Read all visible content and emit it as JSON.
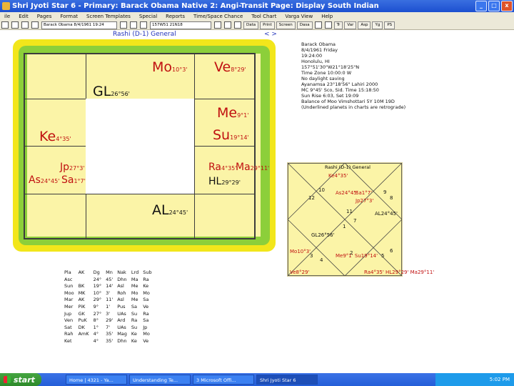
{
  "window": {
    "title": "Shri Jyoti Star 6  - Primary: Barack Obama      Native 2: Angi-Transit         Page: Display South Indian",
    "minimize": "_",
    "maximize": "□",
    "close": "x"
  },
  "menu": [
    "ile",
    "Edit",
    "Pages",
    "Format",
    "Screen Templates",
    "Special",
    "Reports",
    "Time/Space Chance",
    "Tool Chart",
    "Varga View",
    "Help"
  ],
  "toolbar": {
    "date_field": "Barack Obama 8/4/1961 19:24",
    "coord_field": "157W51 21N18",
    "buttons": [
      "Data",
      "Print",
      "Screen",
      "Dasa",
      "Tr",
      "Var",
      "Asp",
      "Yg",
      "PS"
    ]
  },
  "chart": {
    "title": "Rashi (D-1) General",
    "nav": "< >",
    "Mo": {
      "name": "Mo",
      "deg": "10°3'"
    },
    "Ve": {
      "name": "Ve",
      "deg": "8°29'"
    },
    "GL": {
      "name": "GL",
      "deg": "26°56'"
    },
    "Me": {
      "name": "Me",
      "deg": "9°1'"
    },
    "Su": {
      "name": "Su",
      "deg": "19°14'"
    },
    "Ke": {
      "name": "Ke",
      "deg": "4°35'"
    },
    "Jp": {
      "name": "Jp",
      "deg": "27°3'"
    },
    "As": {
      "name": "As",
      "deg": "24°45'"
    },
    "Sa": {
      "name": "Sa",
      "deg": "1°7'"
    },
    "Ra": {
      "name": "Ra",
      "deg": "4°35'"
    },
    "Ma": {
      "name": "Ma",
      "deg": "29°11'"
    },
    "HL": {
      "name": "HL",
      "deg": "29°29'"
    },
    "AL": {
      "name": "AL",
      "deg": "24°45'"
    }
  },
  "info": {
    "lines": [
      "Barack Obama",
      "8/4/1961 Friday",
      "19:24:00",
      "Honolulu, HI",
      "157°51'30\"W21°18'25\"N",
      "Time Zone 10:00:0 W",
      "No daylight saving",
      "Ayanamsa 23°18'56\" Lahiri 2000",
      "MC 9°45' Sco, Sid. Time 15:18:50",
      "Sun Rise 6:03, Set 19:09",
      "Balance of Moo Vimshottari 5Y 10M 19D",
      "(Underlined planets in charts are retrograde)"
    ]
  },
  "small_chart": {
    "title": "Rashi (D-1) General",
    "labels": {
      "ke": "Ke4°35'",
      "as": "As24°45'",
      "sa": "Sa1°7'",
      "jp": "Jp27°3'",
      "al": "AL24°45'",
      "gl": "GL26°56'",
      "mo": "Mo10°3'",
      "me_su": "Me9°1' Su19°14'",
      "ve": "Ve8°29'",
      "ra_hl_ma": "Ra4°35' HL29°29' Ma29°11'"
    },
    "house_numbers": [
      "12",
      "10",
      "8",
      "9",
      "7",
      "1",
      "4",
      "3",
      "2",
      "5",
      "6",
      "11"
    ]
  },
  "table": {
    "headers": [
      "Pla",
      "AK",
      "Dg",
      "Mn",
      "Nak",
      "Lrd",
      "Sub"
    ],
    "rows": [
      [
        "Asc",
        "",
        "24°",
        "45'",
        "Dhn",
        "Ma",
        "Ra"
      ],
      [
        "Sun",
        "BK",
        "19°",
        "14'",
        "Asl",
        "Me",
        "Ke"
      ],
      [
        "Moo",
        "MK",
        "10°",
        "3'",
        "Roh",
        "Mo",
        "Mo"
      ],
      [
        "Mar",
        "AK",
        "29°",
        "11'",
        "Asl",
        "Me",
        "Sa"
      ],
      [
        "Mer",
        "PiK",
        "9°",
        "1'",
        "Pus",
        "Sa",
        "Ve"
      ],
      [
        "Jup",
        "GK",
        "27°",
        "3'",
        "UAs",
        "Su",
        "Ra"
      ],
      [
        "Ven",
        "PuK",
        "8°",
        "29'",
        "Ard",
        "Ra",
        "Sa"
      ],
      [
        "Sat",
        "DK",
        "1°",
        "7'",
        "UAs",
        "Su",
        "Jp"
      ],
      [
        "Rah",
        "AmK",
        "4°",
        "35'",
        "Mag",
        "Ke",
        "Mo"
      ],
      [
        "Ket",
        "",
        "4°",
        "35'",
        "Dhn",
        "Ke",
        "Ve"
      ]
    ]
  },
  "taskbar": {
    "start": "start",
    "tasks": [
      "Home | 4321 - Ya...",
      "Understanding Te...",
      "3 Microsoft Offi...",
      "Shri Jyoti Star 6"
    ],
    "tray": "5:02 PM"
  }
}
